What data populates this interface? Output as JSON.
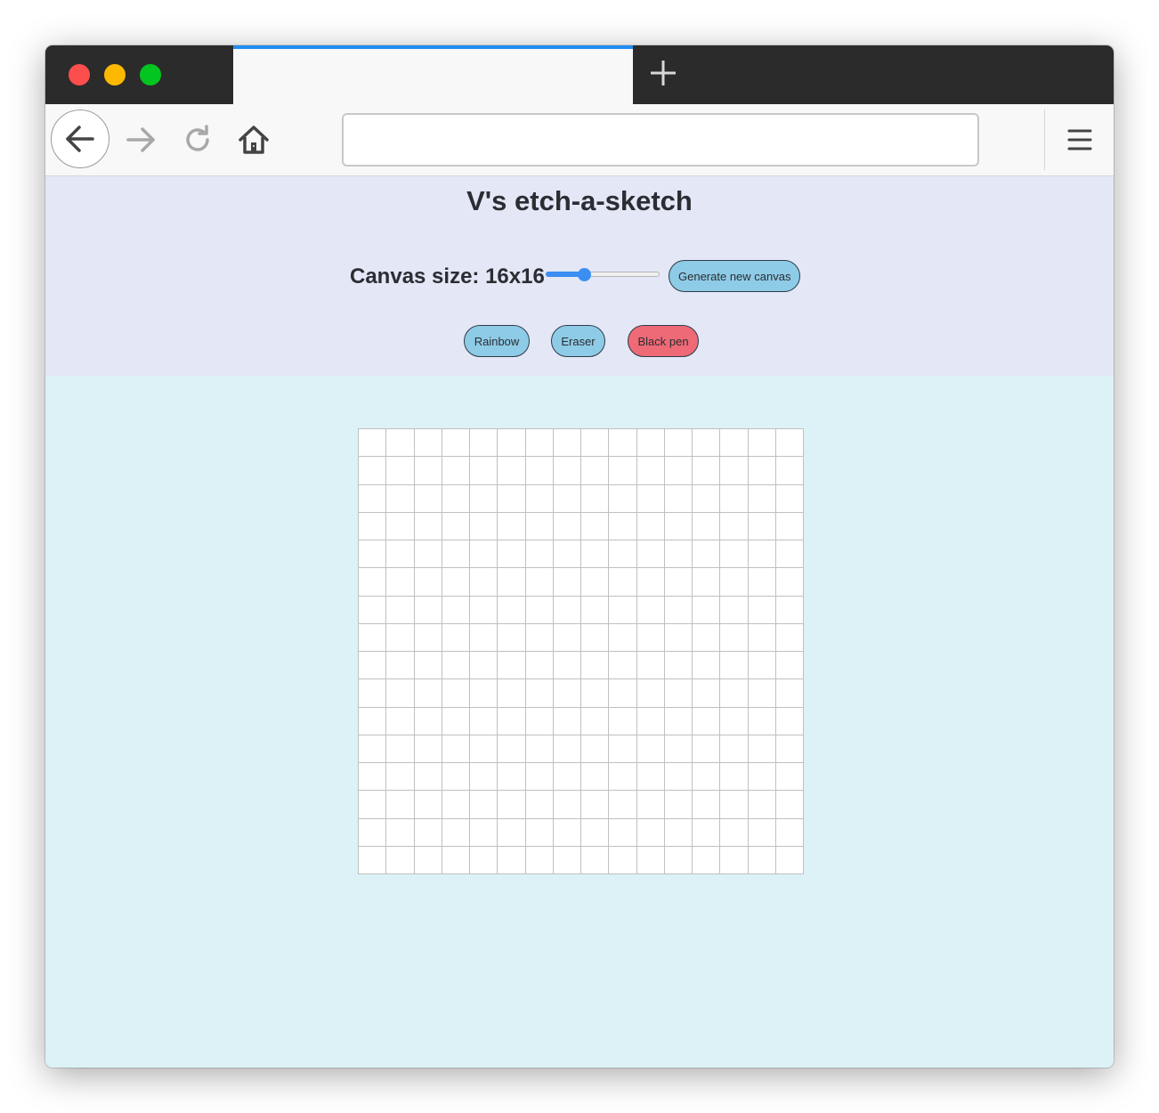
{
  "browser": {
    "url": "",
    "icons": {
      "back": "arrow-left-icon",
      "forward": "arrow-right-icon",
      "reload": "reload-icon",
      "home": "home-icon",
      "new_tab": "plus-icon",
      "menu": "hamburger-menu-icon"
    },
    "colors": {
      "tab_accent": "#1f8cf0",
      "titlebar": "#2b2b2b"
    }
  },
  "page": {
    "title": "V's etch-a-sketch",
    "canvas_size_label": "Canvas size: 16x16",
    "slider": {
      "value": 16,
      "min": 1,
      "max": 100
    },
    "generate_button": "Generate new canvas",
    "modes": [
      {
        "label": "Rainbow",
        "color": "#8ecbe6"
      },
      {
        "label": "Eraser",
        "color": "#8ecbe6"
      },
      {
        "label": "Black pen",
        "color": "#ee6a76"
      }
    ],
    "grid": {
      "rows": 16,
      "cols": 16,
      "cell_color": "#ffffff",
      "line_color": "#c0c0c0"
    },
    "colors": {
      "header_bg": "#e3e7f6",
      "body_bg": "#dcf2f7",
      "button_bg": "#8ecbe6",
      "active_button_bg": "#ee6a76"
    }
  }
}
